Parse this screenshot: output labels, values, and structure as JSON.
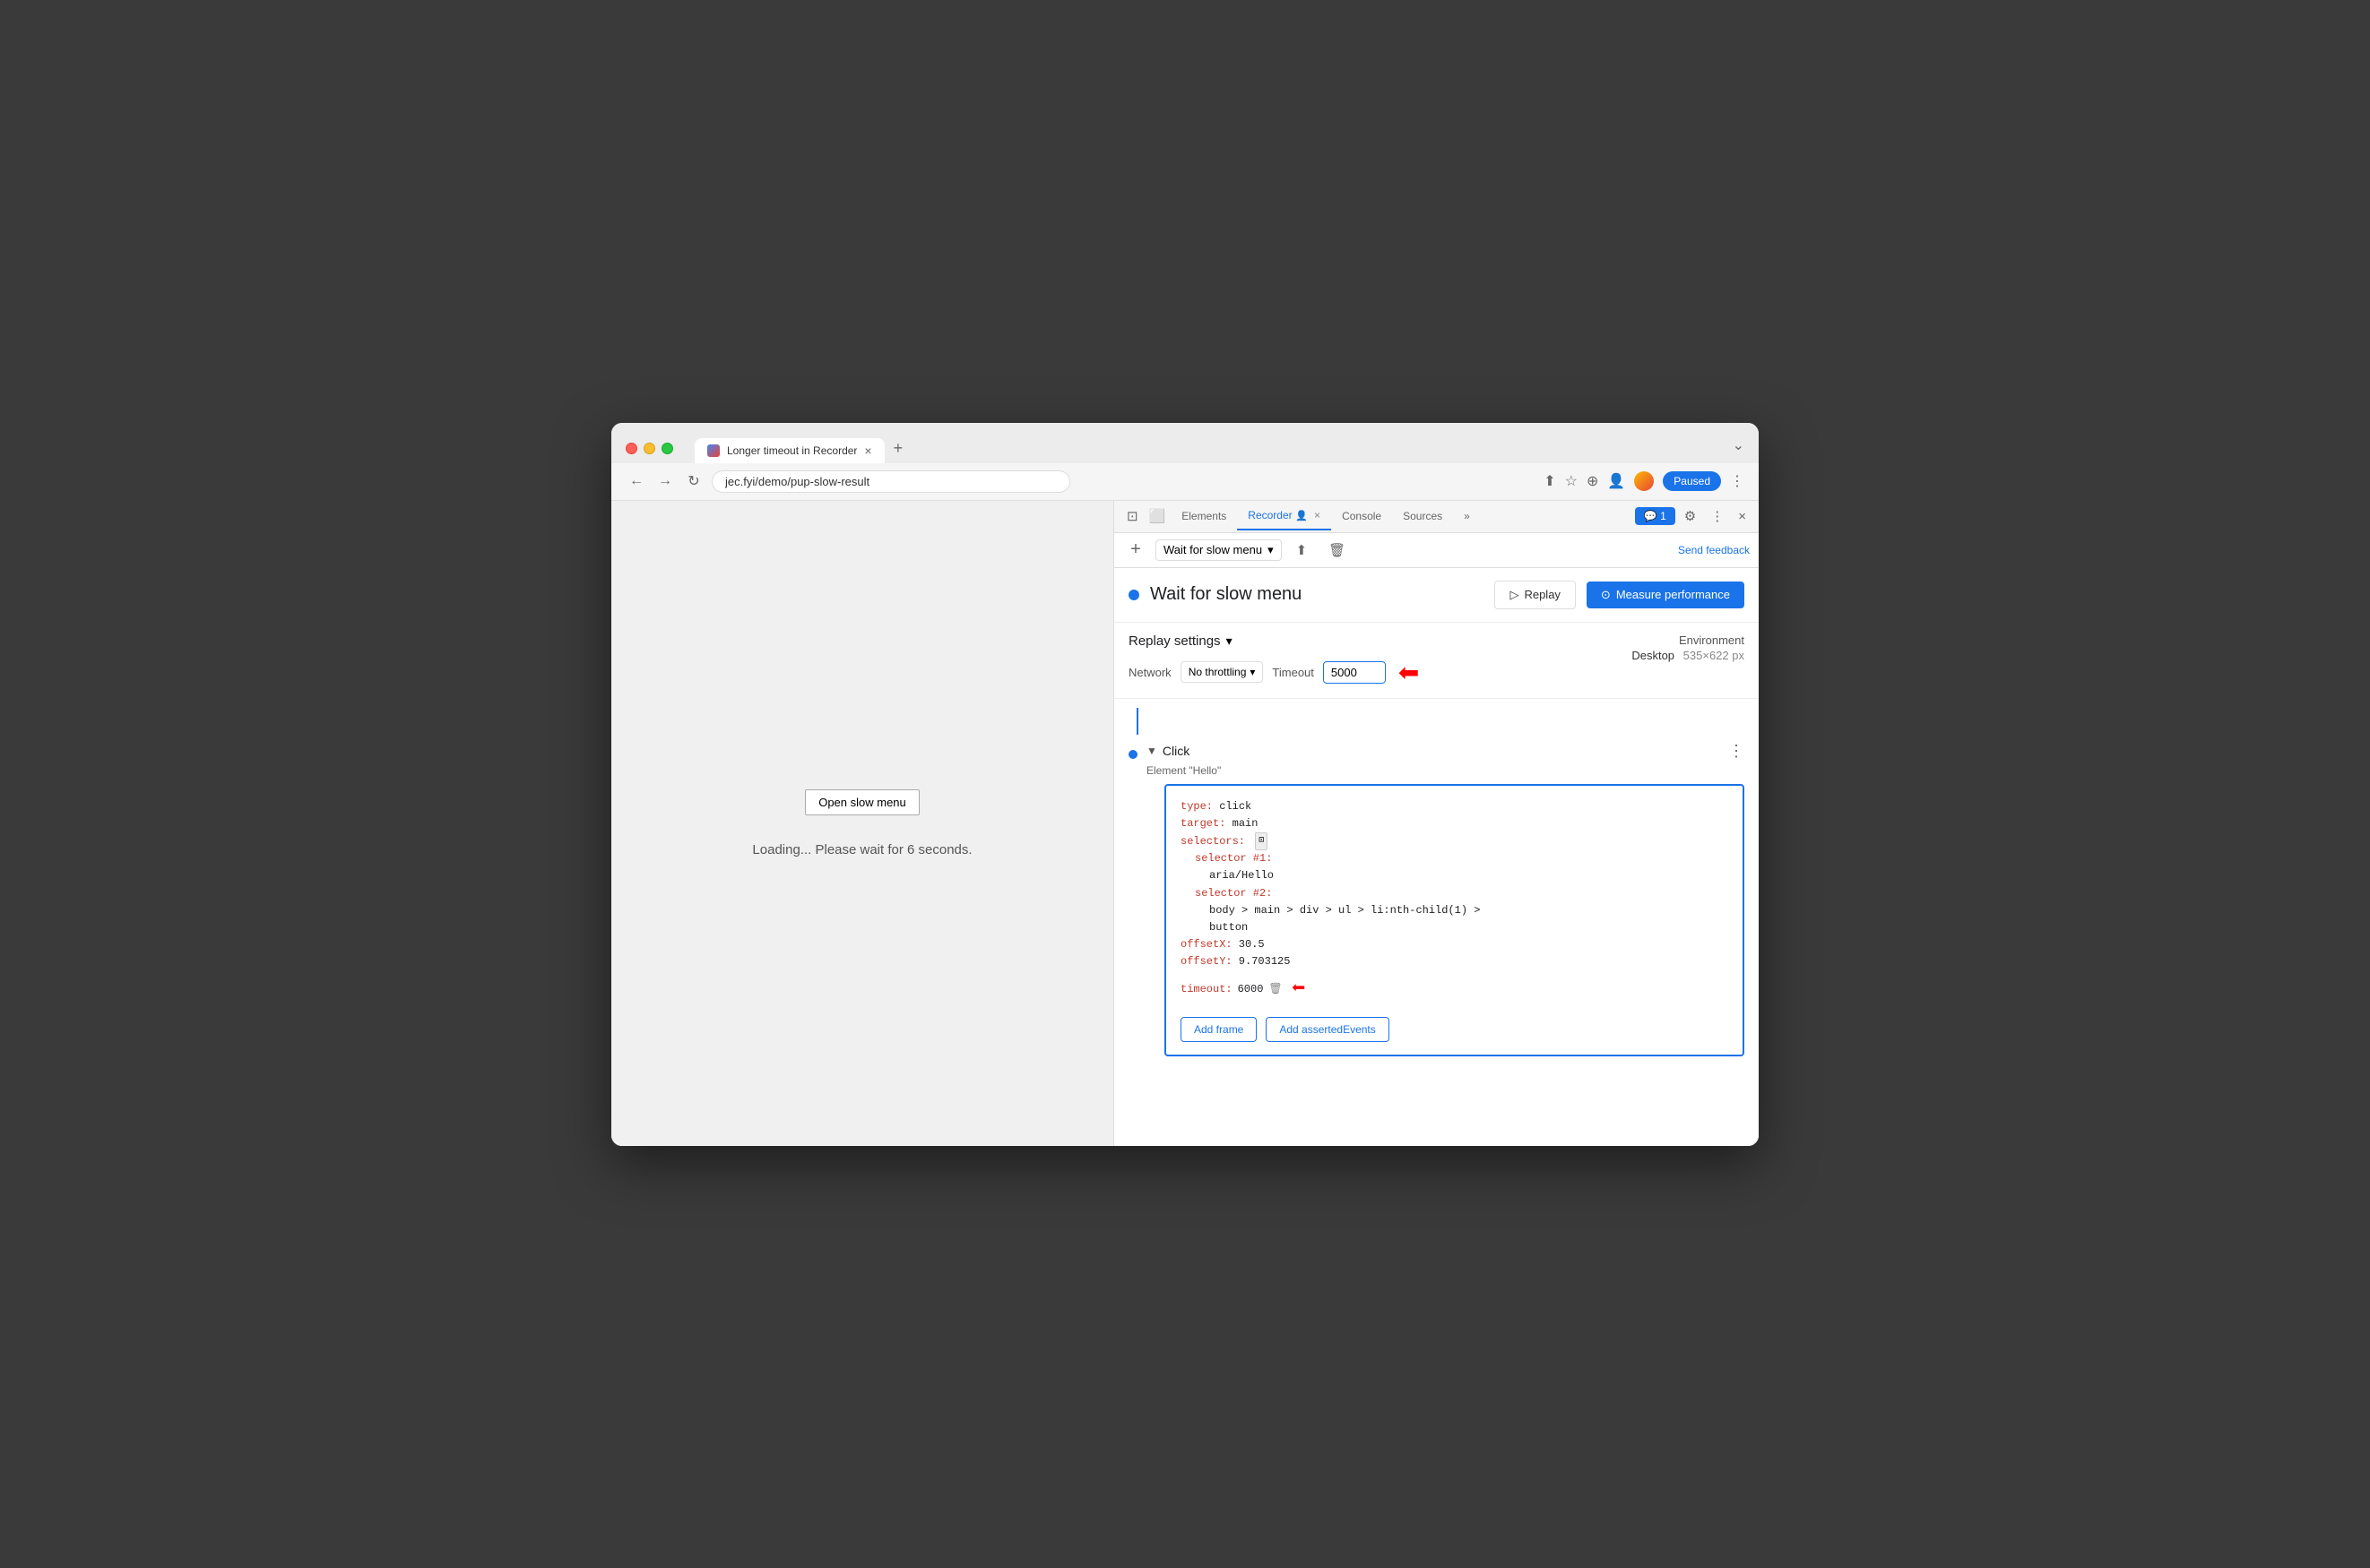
{
  "browser": {
    "title": "Longer timeout in Recorder",
    "url": "jec.fyi/demo/pup-slow-result",
    "paused_label": "Paused"
  },
  "tabs": {
    "elements": "Elements",
    "recorder": "Recorder",
    "console": "Console",
    "sources": "Sources",
    "more": "»"
  },
  "toolbar": {
    "recording_name": "Wait for slow menu",
    "send_feedback": "Send feedback"
  },
  "recording": {
    "title": "Wait for slow menu",
    "replay_label": "Replay",
    "measure_label": "Measure performance"
  },
  "replay_settings": {
    "title": "Replay settings",
    "network_label": "Network",
    "network_value": "No throttling",
    "timeout_label": "Timeout",
    "timeout_value": "5000"
  },
  "environment": {
    "label": "Environment",
    "value": "Desktop",
    "resolution": "535×622 px"
  },
  "step": {
    "type": "Click",
    "subtitle": "Element \"Hello\"",
    "menu_icon": "⋮"
  },
  "code": {
    "type_key": "type:",
    "type_val": " click",
    "target_key": "target:",
    "target_val": " main",
    "selectors_key": "selectors:",
    "selector1_key": "selector #1:",
    "selector1_val": "aria/Hello",
    "selector2_key": "selector #2:",
    "selector2_val": "body > main > div > ul > li:nth-child(1) >",
    "selector2_val2": "button",
    "offsetX_key": "offsetX:",
    "offsetX_val": " 30.5",
    "offsetY_key": "offsetY:",
    "offsetY_val": " 9.703125",
    "timeout_key": "timeout:",
    "timeout_val": " 6000",
    "add_frame_label": "Add frame",
    "add_asserted_label": "Add assertedEvents"
  },
  "webpage": {
    "button_label": "Open slow menu",
    "loading_text": "Loading... Please wait for 6 seconds."
  }
}
